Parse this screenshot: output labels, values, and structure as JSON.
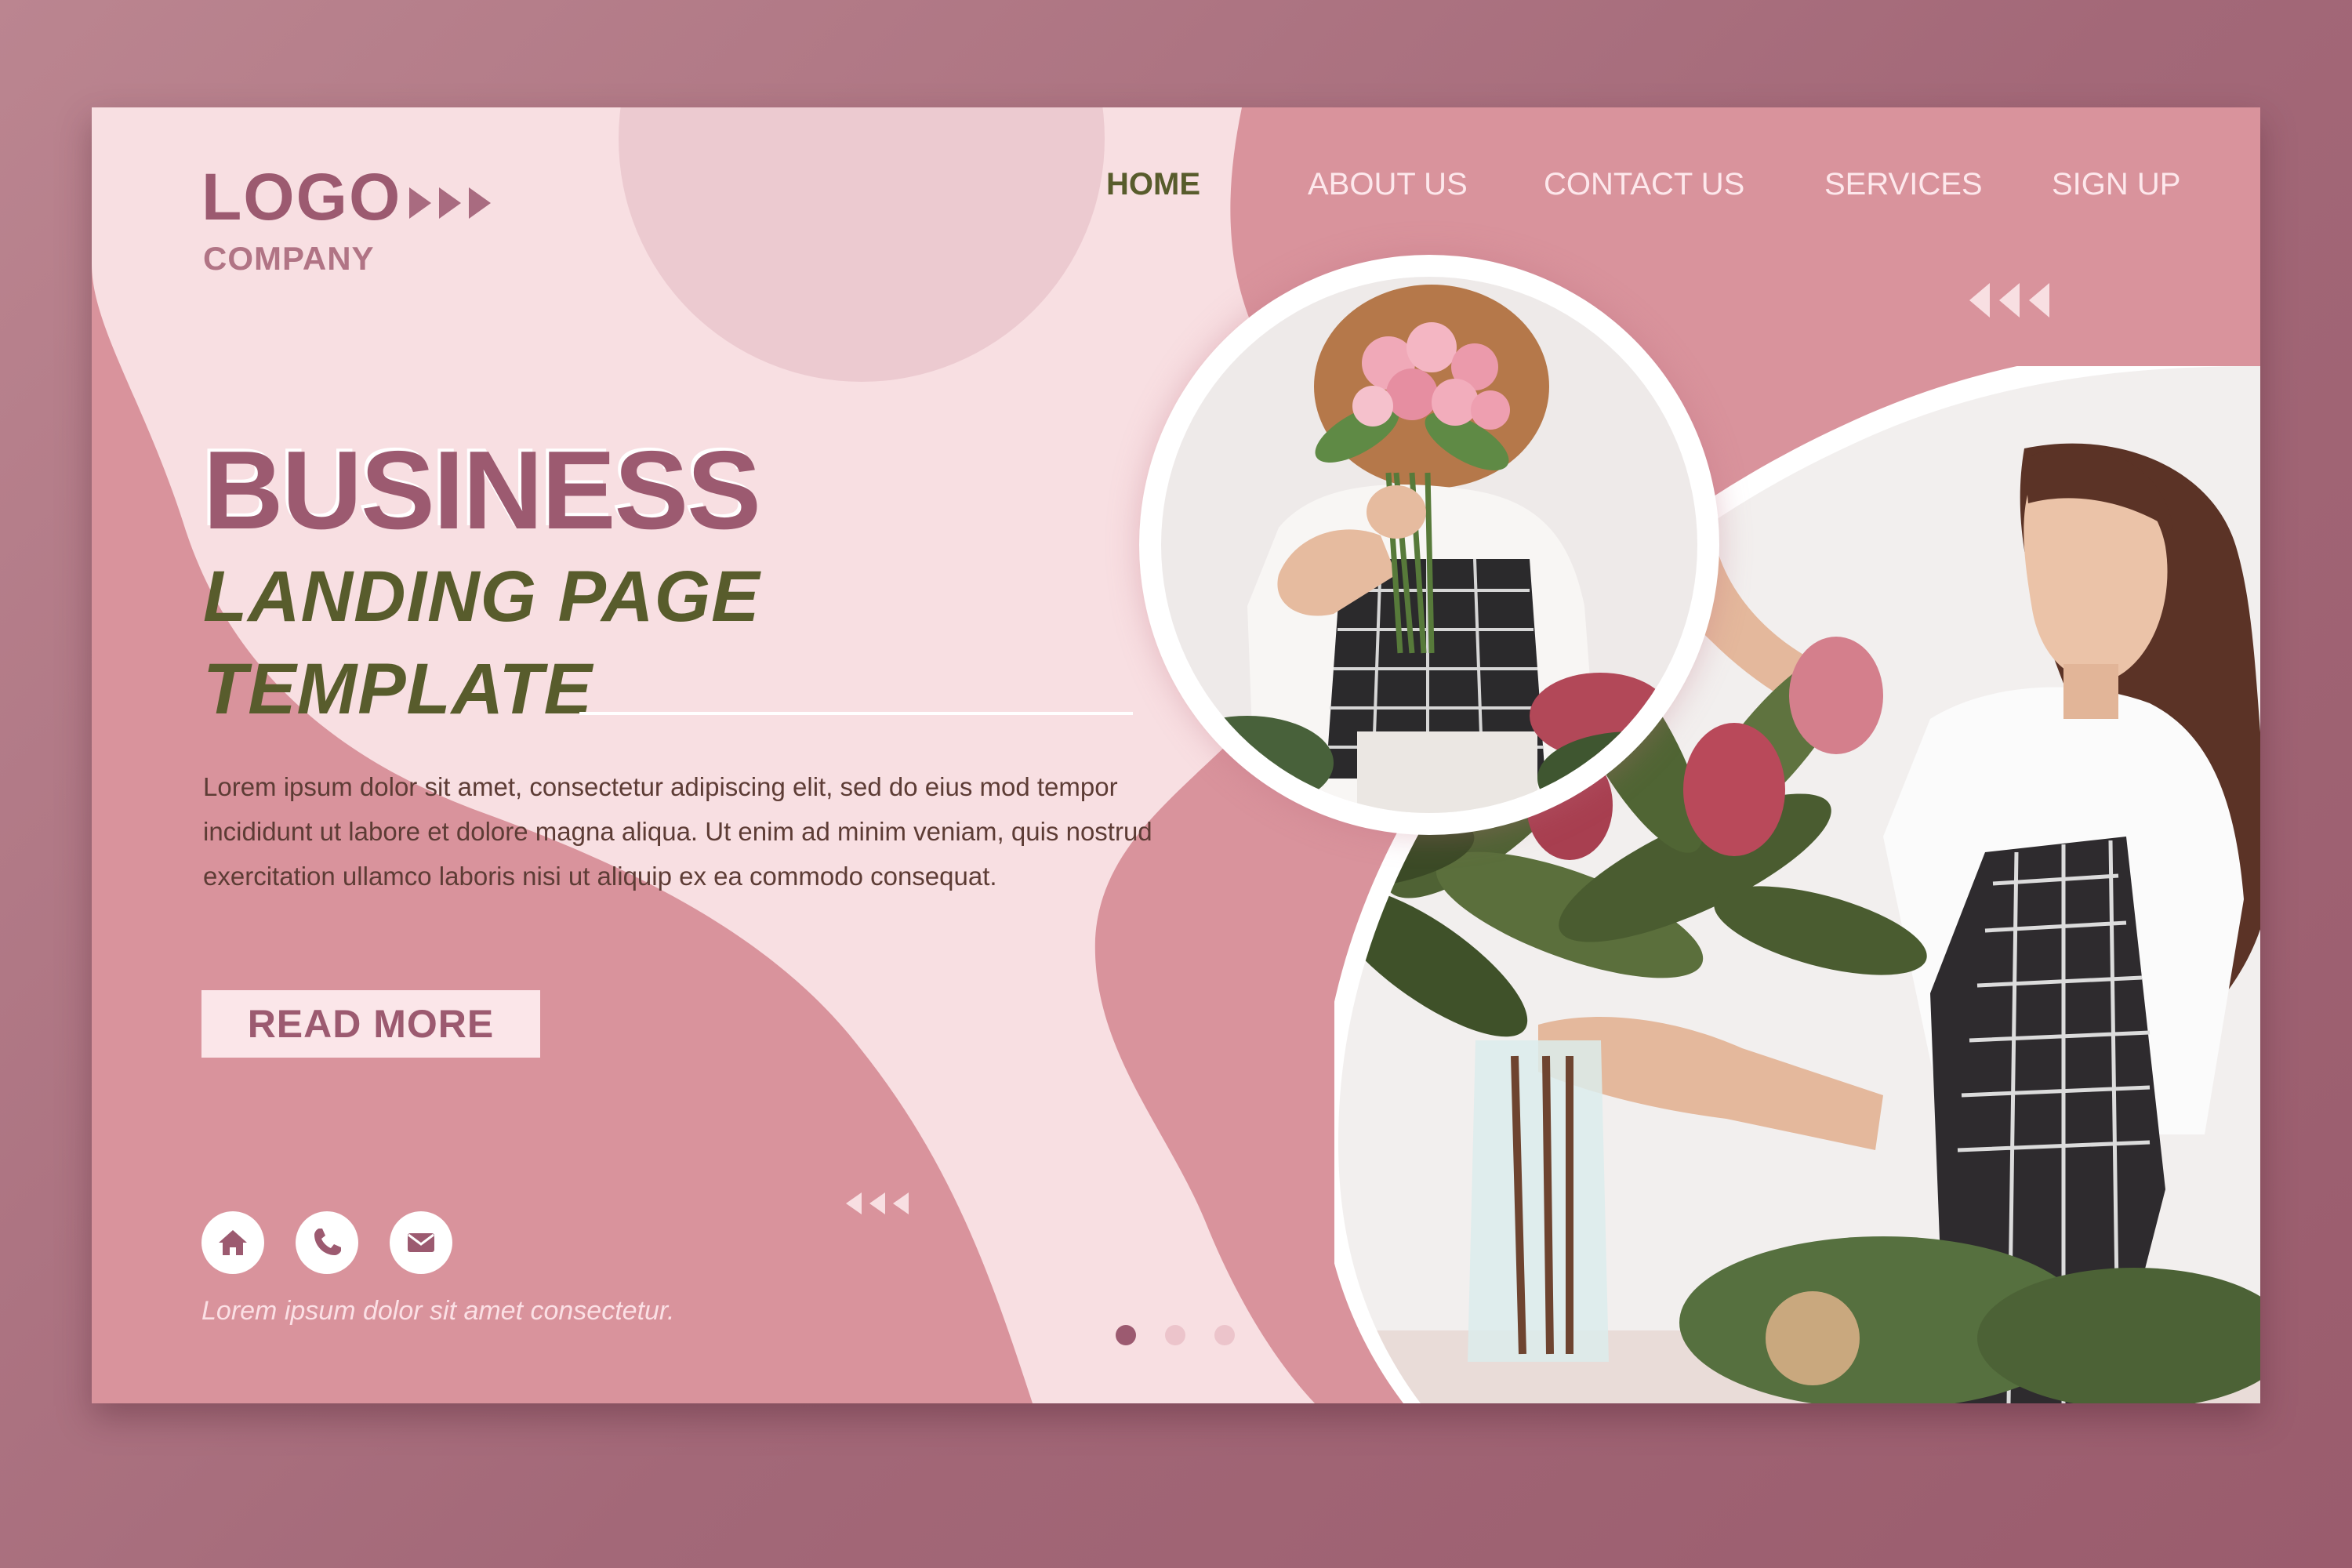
{
  "brand": {
    "logo": "LOGO",
    "company": "COMPANY"
  },
  "nav": {
    "items": [
      {
        "label": "HOME",
        "active": true
      },
      {
        "label": "ABOUT US",
        "active": false
      },
      {
        "label": "CONTACT US",
        "active": false
      },
      {
        "label": "SERVICES",
        "active": false
      },
      {
        "label": "SIGN UP",
        "active": false
      }
    ]
  },
  "hero": {
    "title": "BUSINESS",
    "subtitle_line1": "LANDING PAGE",
    "subtitle_line2": "TEMPLATE",
    "description": "Lorem ipsum dolor sit amet, consectetur adipiscing elit, sed do eius mod tempor incididunt ut labore et dolore magna aliqua. Ut enim ad minim veniam, quis nostrud exercitation ullamco laboris nisi ut aliquip ex ea commodo consequat.",
    "cta_label": "READ MORE"
  },
  "contact_icons": [
    "home-icon",
    "phone-icon",
    "mail-icon"
  ],
  "footer": {
    "note": "Lorem ipsum dolor sit amet consectetur."
  },
  "carousel": {
    "total_slides": 3,
    "active_slide": 1
  },
  "colors": {
    "outer_background": "#a36878",
    "rose": "#d9939c",
    "blush": "#f8dfe2",
    "mauve_text": "#9c5a70",
    "olive_text": "#585c2c",
    "white": "#ffffff"
  }
}
